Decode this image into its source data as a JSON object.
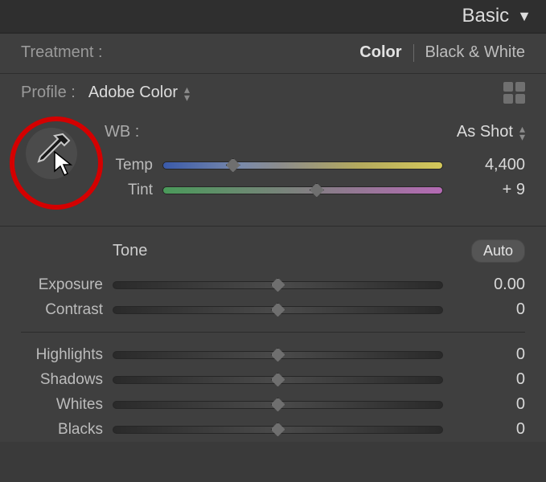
{
  "panel": {
    "title": "Basic"
  },
  "treatment": {
    "label": "Treatment :",
    "color": "Color",
    "bw": "Black & White"
  },
  "profile": {
    "label": "Profile :",
    "value": "Adobe Color"
  },
  "wb": {
    "label": "WB :",
    "value": "As Shot"
  },
  "sliders": {
    "temp": {
      "label": "Temp",
      "value": "4,400",
      "pos": 25
    },
    "tint": {
      "label": "Tint",
      "value": "+ 9",
      "pos": 55
    },
    "exposure": {
      "label": "Exposure",
      "value": "0.00",
      "pos": 50
    },
    "contrast": {
      "label": "Contrast",
      "value": "0",
      "pos": 50
    },
    "highlights": {
      "label": "Highlights",
      "value": "0",
      "pos": 50
    },
    "shadows": {
      "label": "Shadows",
      "value": "0",
      "pos": 50
    },
    "whites": {
      "label": "Whites",
      "value": "0",
      "pos": 50
    },
    "blacks": {
      "label": "Blacks",
      "value": "0",
      "pos": 50
    }
  },
  "tone": {
    "title": "Tone",
    "auto": "Auto"
  }
}
